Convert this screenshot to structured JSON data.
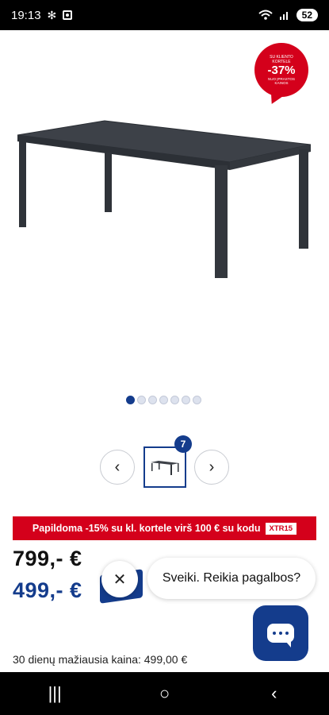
{
  "status_bar": {
    "time": "19:13",
    "battery": "52"
  },
  "badge": {
    "top_text": "SU KLIENTO KORTELE",
    "percent": "-37%",
    "bottom_text": "NUO ĮPRASTOS KAINOS"
  },
  "gallery": {
    "dot_count": 7,
    "active_dot": 0,
    "thumb_count": "7"
  },
  "icons": {
    "prev": "chevron-left-icon",
    "next": "chevron-right-icon",
    "close": "close-icon",
    "chat": "chat-icon"
  },
  "promo": {
    "text": "Papildoma -15% su kl. kortele virš 100 € su kodu",
    "code": "XTR15"
  },
  "prices": {
    "old": "799,- €",
    "new": "499,- €"
  },
  "chat": {
    "greeting": "Sveiki. Reikia pagalbos?"
  },
  "info": {
    "lowest_price": "30 dienų mažiausia kaina: 499,00 €"
  },
  "nav": {
    "recents": "|||",
    "home": "○",
    "back": "‹"
  },
  "colors": {
    "brand_blue": "#143c8c",
    "brand_red": "#d4001b"
  }
}
